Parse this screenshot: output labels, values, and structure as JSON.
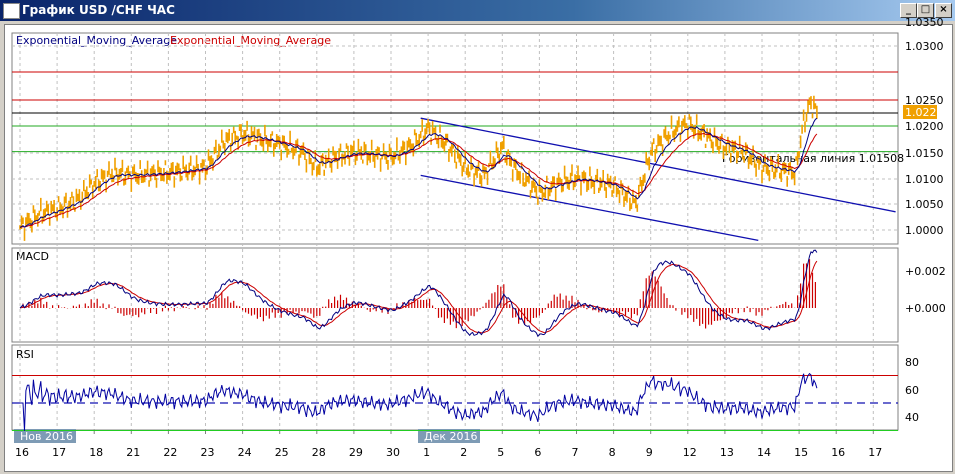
{
  "window": {
    "title": "График USD /CHF  ЧАС",
    "buttons": [
      "_",
      "□",
      "×"
    ]
  },
  "legend": {
    "ema_blue": "Exponential_Moving_Average",
    "ema_red": "Exponential_Moving_Average"
  },
  "price_axis": [
    "1.0350",
    "1.0300",
    "1.0250",
    "1.0200",
    "1.0150",
    "1.0100",
    "1.0050",
    "1.0000"
  ],
  "current_price": "1.0225",
  "hline_label": "Горизонтальная линия 1.01508",
  "macd": {
    "title": "MACD",
    "ticks": [
      "+0.002",
      "+0.000"
    ]
  },
  "rsi": {
    "title": "RSI",
    "ticks": [
      "80",
      "60",
      "40"
    ]
  },
  "x_axis": {
    "days": [
      "16",
      "17",
      "18",
      "21",
      "22",
      "23",
      "24",
      "25",
      "28",
      "29",
      "30",
      "1",
      "2",
      "5",
      "6",
      "7",
      "8",
      "9",
      "12",
      "13",
      "14",
      "15",
      "16",
      "17"
    ],
    "month_labels": [
      "Нов 2016",
      "Дек 2016"
    ]
  },
  "colors": {
    "price": "#f0a000",
    "ema_fast": "#000080",
    "ema_slow": "#cc0000",
    "grid": "#c0c0c0"
  },
  "chart_data": {
    "type": "line",
    "title": "USD/CHF H1",
    "price": [
      [
        0,
        1.0005
      ],
      [
        0.5,
        1.003
      ],
      [
        1,
        1.004
      ],
      [
        1.6,
        1.006
      ],
      [
        2,
        1.009
      ],
      [
        2.5,
        1.011
      ],
      [
        3,
        1.0105
      ],
      [
        4,
        1.011
      ],
      [
        5,
        1.012
      ],
      [
        5.5,
        1.017
      ],
      [
        6,
        1.0185
      ],
      [
        6.5,
        1.0175
      ],
      [
        7,
        1.0165
      ],
      [
        7.6,
        1.015
      ],
      [
        8,
        1.012
      ],
      [
        8.5,
        1.014
      ],
      [
        9,
        1.015
      ],
      [
        10,
        1.014
      ],
      [
        10.5,
        1.016
      ],
      [
        11,
        1.0195
      ],
      [
        11.5,
        1.0165
      ],
      [
        12,
        1.012
      ],
      [
        12.5,
        1.0105
      ],
      [
        13,
        1.016
      ],
      [
        13.3,
        1.012
      ],
      [
        14,
        1.007
      ],
      [
        14.5,
        1.009
      ],
      [
        15,
        1.01
      ],
      [
        16,
        1.0085
      ],
      [
        16.6,
        1.005
      ],
      [
        17,
        1.015
      ],
      [
        17.5,
        1.0185
      ],
      [
        18,
        1.0205
      ],
      [
        18.6,
        1.0175
      ],
      [
        19,
        1.016
      ],
      [
        19.5,
        1.015
      ],
      [
        20,
        1.012
      ],
      [
        20.5,
        1.0115
      ],
      [
        20.9,
        1.011
      ],
      [
        21.1,
        1.02
      ],
      [
        21.3,
        1.0245
      ],
      [
        21.5,
        1.0225
      ]
    ],
    "hlines": [
      1.03,
      1.025,
      1.0225,
      1.02,
      1.01508
    ],
    "channel": {
      "upper": [
        [
          10.8,
          1.0215
        ],
        [
          23.6,
          1.0035
        ]
      ],
      "lower": [
        [
          10.8,
          1.0105
        ],
        [
          19.9,
          0.998
        ]
      ]
    },
    "rsi_levels": [
      70,
      50,
      30
    ]
  }
}
